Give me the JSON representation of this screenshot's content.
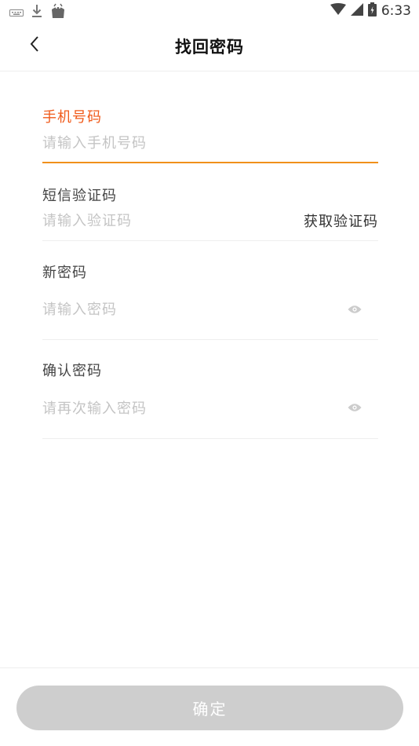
{
  "status_bar": {
    "time": "6:33",
    "left_icons": [
      "keyboard-icon",
      "download-icon",
      "store-bag-icon"
    ],
    "right_icons": [
      "wifi-icon",
      "cellular-icon",
      "battery-icon"
    ]
  },
  "nav": {
    "back_icon": "chevron-left-icon",
    "title": "找回密码"
  },
  "form": {
    "phone": {
      "label": "手机号码",
      "placeholder": "请输入手机号码",
      "value": ""
    },
    "sms_code": {
      "label": "短信验证码",
      "placeholder": "请输入验证码",
      "value": "",
      "get_code_label": "获取验证码"
    },
    "new_password": {
      "label": "新密码",
      "placeholder": "请输入密码",
      "value": "",
      "toggle_icon": "eye-icon"
    },
    "confirm_password": {
      "label": "确认密码",
      "placeholder": "请再次输入密码",
      "value": "",
      "toggle_icon": "eye-icon"
    }
  },
  "confirm_button": {
    "label": "确定"
  },
  "colors": {
    "active_label": "#f05a1a",
    "active_underline": "#f0901a",
    "placeholder": "#c4c4c4",
    "button_disabled": "#cecece"
  }
}
